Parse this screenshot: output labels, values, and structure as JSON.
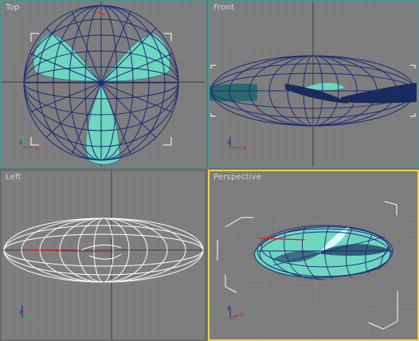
{
  "viewports": {
    "top": {
      "label": "Top"
    },
    "front": {
      "label": "Front"
    },
    "left": {
      "label": "Left"
    },
    "perspective": {
      "label": "Perspective"
    }
  },
  "axes": {
    "x": "x",
    "y": "y",
    "z": "z"
  },
  "colors": {
    "wire_selected": "#1a2a7a",
    "wire_unselected": "#ffffff",
    "blade_fill": "#6fd6c0",
    "grid_minor": "#8a8a8a",
    "grid_major": "#3a3a3a",
    "active_border": "#e8d64a"
  }
}
